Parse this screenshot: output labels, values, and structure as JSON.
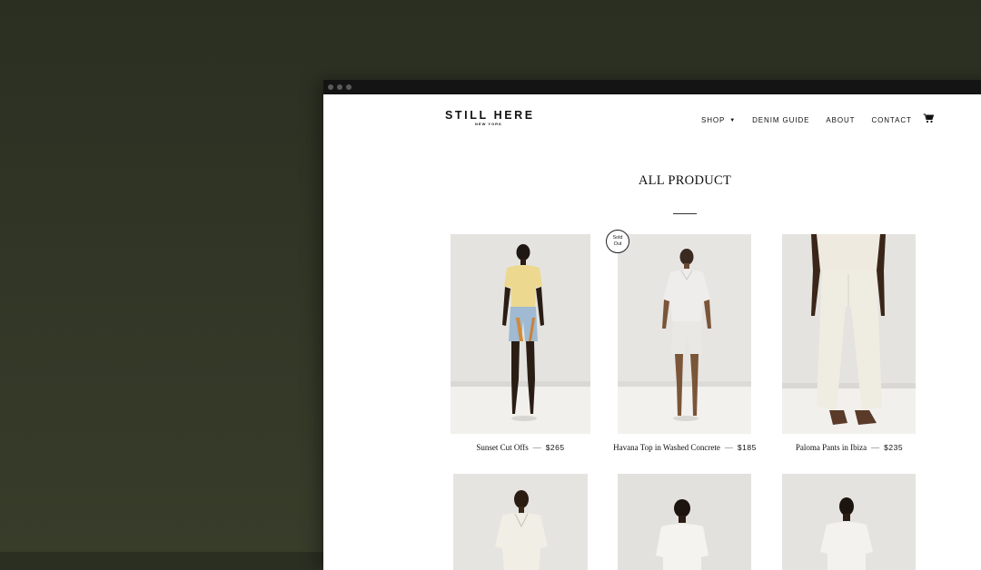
{
  "brand": {
    "name": "STILL HERE",
    "tagline": "NEW YORK"
  },
  "nav": {
    "items": [
      {
        "label": "SHOP",
        "has_dropdown": true
      },
      {
        "label": "DENIM GUIDE"
      },
      {
        "label": "ABOUT"
      },
      {
        "label": "CONTACT"
      }
    ],
    "cart_icon": "cart-icon"
  },
  "collection": {
    "title": "ALL PRODUCT"
  },
  "products": [
    {
      "name": "Sunset Cut Offs",
      "dash": "—",
      "price": "$265",
      "sold_out": false
    },
    {
      "name": "Havana Top in Washed Concrete",
      "dash": "—",
      "price": "$185",
      "sold_out": true,
      "badge_line1": "Sold",
      "badge_line2": "Out"
    },
    {
      "name": "Paloma Pants in Ibiza",
      "dash": "—",
      "price": "$235",
      "sold_out": false
    },
    {
      "name": "",
      "price": ""
    },
    {
      "name": "",
      "price": ""
    },
    {
      "name": "",
      "price": ""
    }
  ],
  "colors": {
    "backdrop": "#333826",
    "page": "#ffffff",
    "text": "#111111",
    "studio_wall": "#e6e5e2",
    "studio_floor": "#f2f1ef"
  }
}
